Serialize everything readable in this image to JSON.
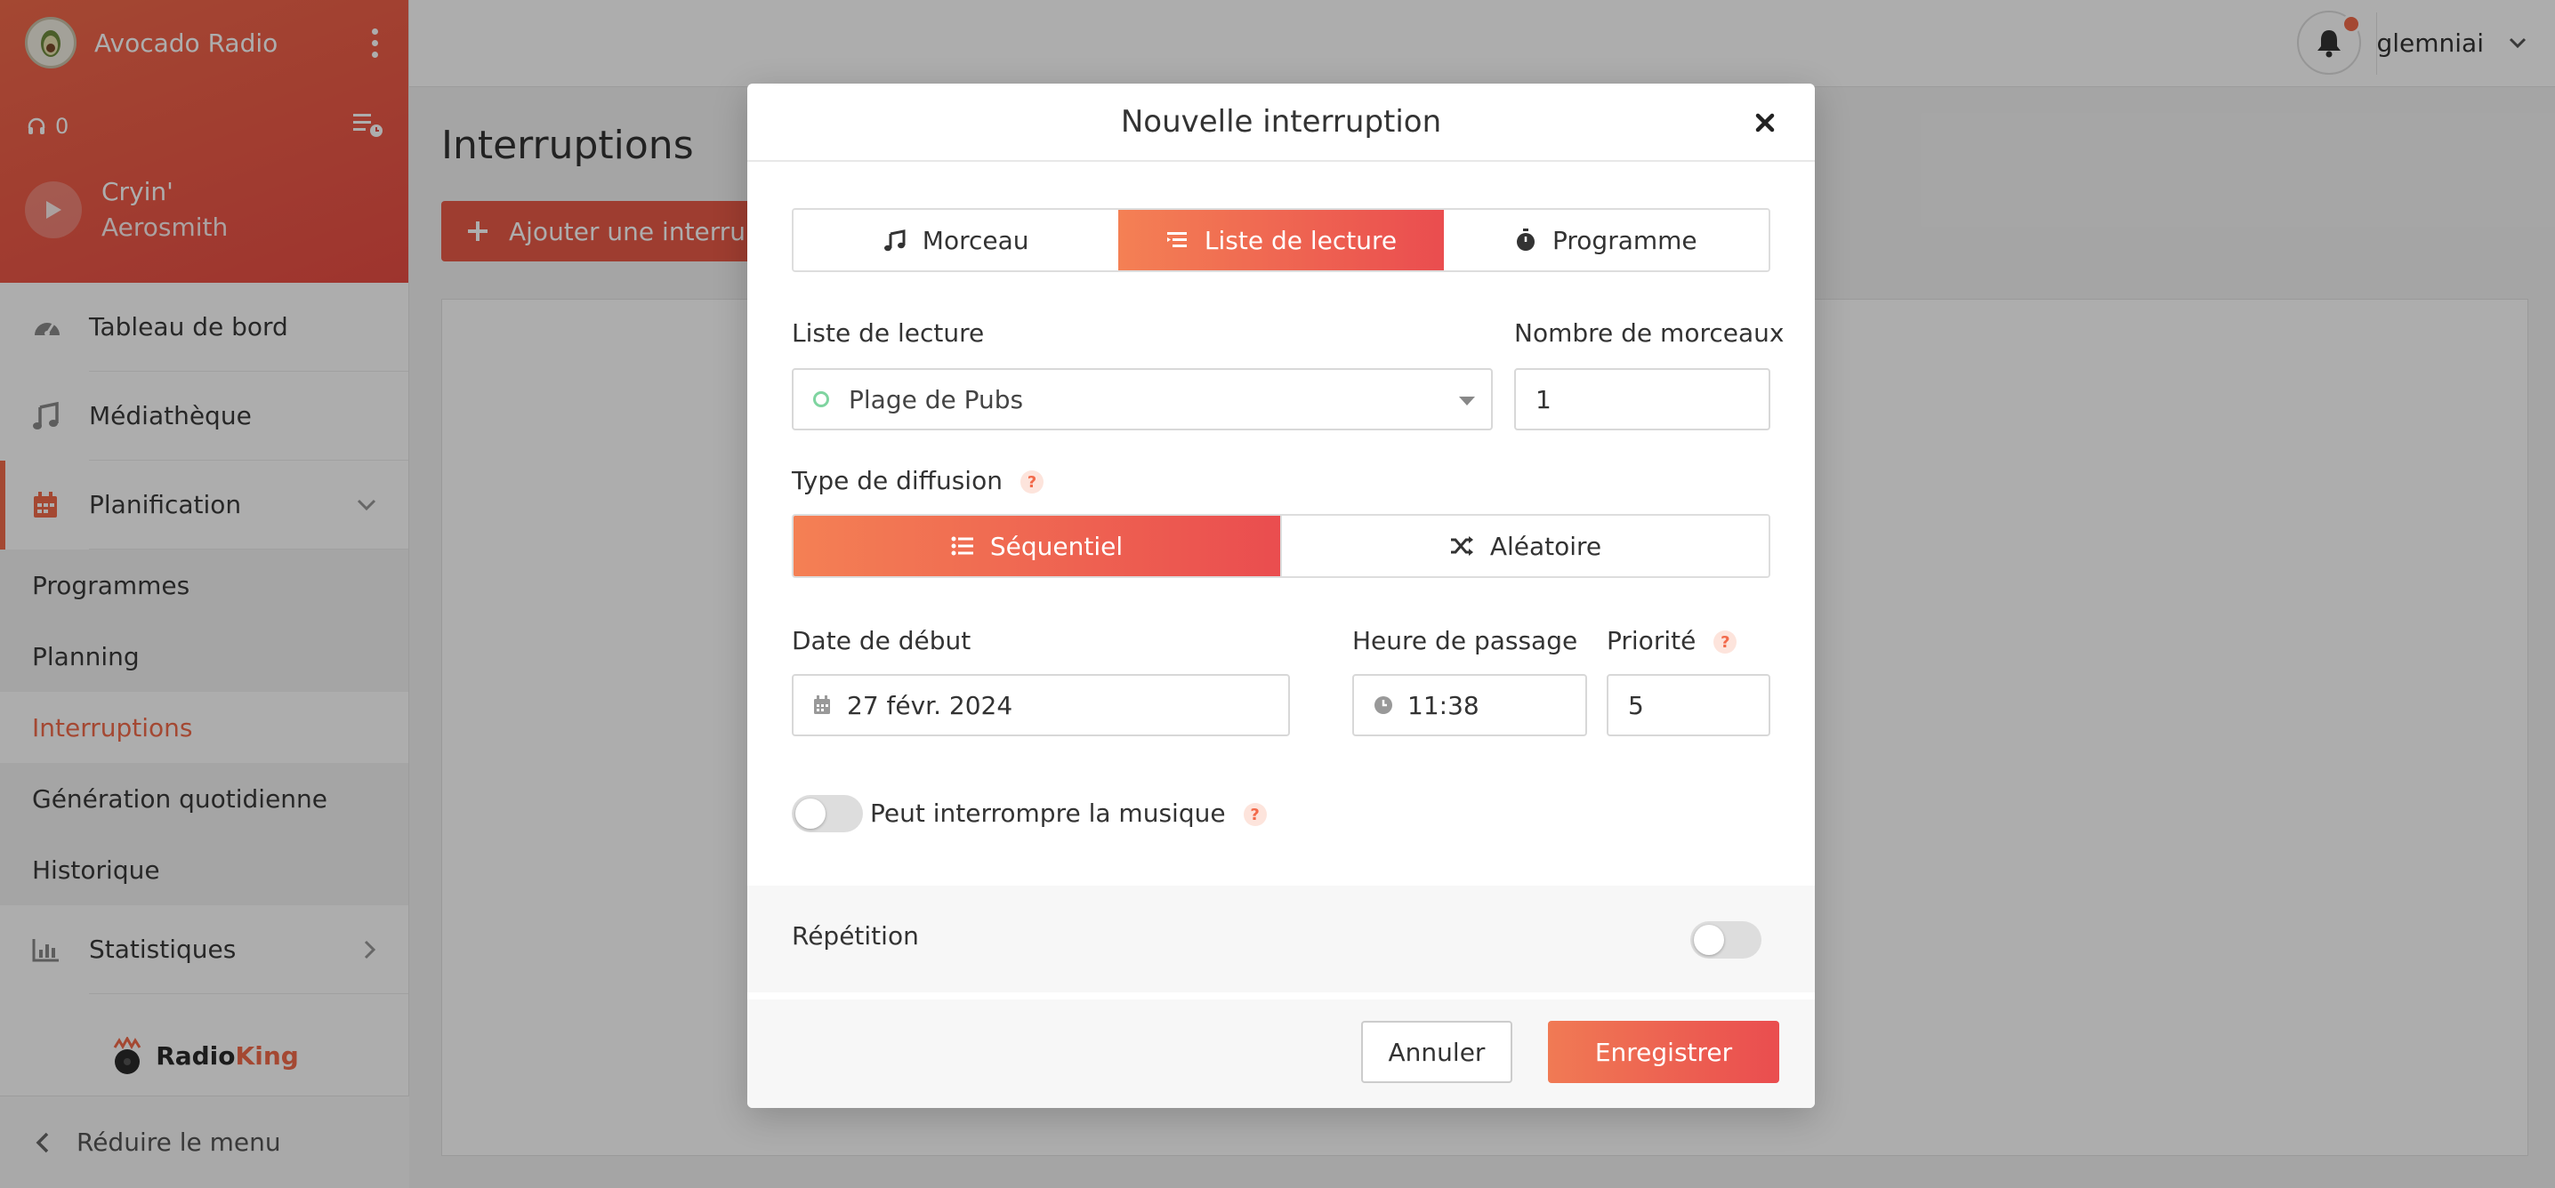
{
  "app": {
    "station_name": "Avocado Radio",
    "listeners_count": "0",
    "now_playing": {
      "title": "Cryin'",
      "artist": "Aerosmith"
    }
  },
  "sidebar": {
    "items": [
      {
        "label": "Tableau de bord",
        "icon": "dashboard-icon"
      },
      {
        "label": "Médiathèque",
        "icon": "music-note-icon"
      },
      {
        "label": "Planification",
        "icon": "calendar-icon"
      },
      {
        "label": "Statistiques",
        "icon": "bar-chart-icon"
      }
    ],
    "submenu": [
      "Programmes",
      "Planning",
      "Interruptions",
      "Génération quotidienne",
      "Historique"
    ],
    "brand_radio": "Radio",
    "brand_king": "King",
    "reduce_label": "Réduire le menu"
  },
  "topbar": {
    "username": "glemniai"
  },
  "page": {
    "title": "Interruptions",
    "add_button": "Ajouter une interruption"
  },
  "modal": {
    "title": "Nouvelle interruption",
    "tabs": [
      "Morceau",
      "Liste de lecture",
      "Programme"
    ],
    "playlist_label": "Liste de lecture",
    "playlist_value": "Plage de Pubs",
    "count_label": "Nombre de morceaux",
    "count_value": "1",
    "diffusion_label": "Type de diffusion",
    "diffusion_options": [
      "Séquentiel",
      "Aléatoire"
    ],
    "start_date_label": "Date de début",
    "start_date_value": "27 févr. 2024",
    "time_label": "Heure de passage",
    "time_value": "11:38",
    "priority_label": "Priorité",
    "priority_value": "5",
    "interrupt_label": "Peut interrompre la musique",
    "repeat_label": "Répétition",
    "cancel": "Annuler",
    "save": "Enregistrer",
    "help_glyph": "?"
  },
  "colors": {
    "accent": "#f26a4b",
    "accent_dark": "#ea4d4f"
  }
}
